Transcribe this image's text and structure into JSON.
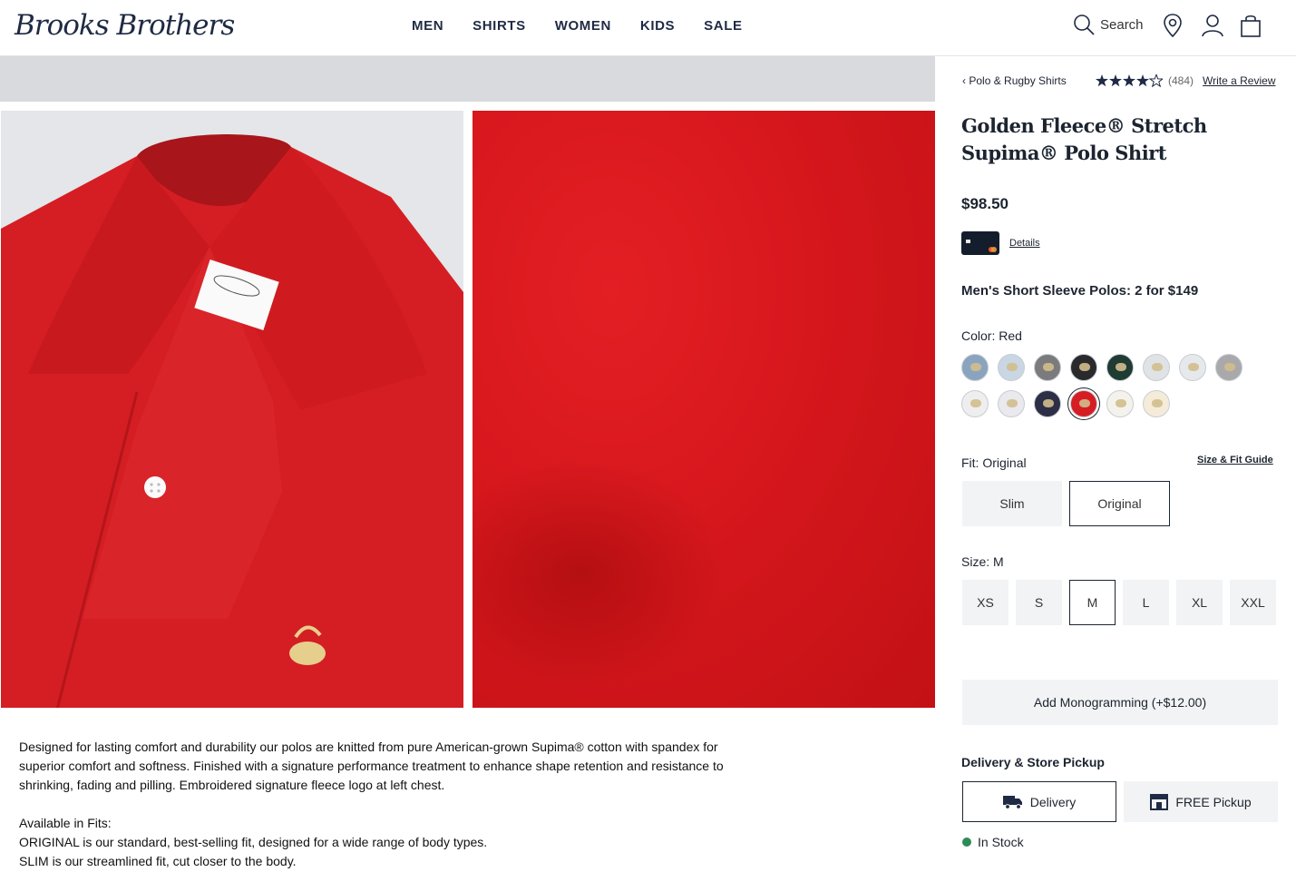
{
  "header": {
    "logo": "Brooks Brothers",
    "nav": [
      "MEN",
      "SHIRTS",
      "WOMEN",
      "KIDS",
      "SALE"
    ],
    "search_label": "Search"
  },
  "breadcrumb": {
    "back": "‹",
    "label": "Polo & Rugby Shirts"
  },
  "rating": {
    "stars": 4.5,
    "count": "(484)",
    "write_review": "Write a Review"
  },
  "product": {
    "title": "Golden Fleece® Stretch Supima® Polo Shirt",
    "price": "$98.50",
    "card_details": "Details",
    "promo": "Men's Short Sleeve Polos: 2 for $149",
    "description": "Designed for lasting comfort and durability our polos are knitted from pure American-grown Supima® cotton with spandex for superior comfort and softness. Finished with a signature performance treatment to enhance shape retention and resistance to shrinking, fading and pilling. Embroidered signature fleece logo at left chest.",
    "fits_heading": "Available in Fits:",
    "fits_original": "ORIGINAL is our standard, best-selling fit, designed for a wide range of body types.",
    "fits_slim": "SLIM is our streamlined fit, cut closer to the body."
  },
  "color": {
    "label": "Color:",
    "value": "Red",
    "swatches": [
      "#8aa4bf",
      "#c9d6e3",
      "#7b7b7d",
      "#2a2a2c",
      "#1f3b33",
      "#dfe3e6",
      "#e6e9ec",
      "#a9a9ab",
      "#eeeeef",
      "#e9e9ee",
      "#2c2f45",
      "#d61d23",
      "#f4f2ec",
      "#f4ecd9"
    ]
  },
  "fit": {
    "label": "Fit:",
    "value": "Original",
    "guide": "Size & Fit Guide",
    "options": [
      "Slim",
      "Original"
    ]
  },
  "size": {
    "label": "Size:",
    "value": "M",
    "options": [
      "XS",
      "S",
      "M",
      "L",
      "XL",
      "XXL"
    ]
  },
  "monogram": "Add Monogramming (+$12.00)",
  "delivery": {
    "heading": "Delivery & Store Pickup",
    "delivery_label": "Delivery",
    "pickup_label": "FREE Pickup",
    "stock": "In Stock"
  },
  "colors": {
    "accent": "#1c2430",
    "product_red": "#d61d23",
    "in_stock": "#2e8b57"
  }
}
